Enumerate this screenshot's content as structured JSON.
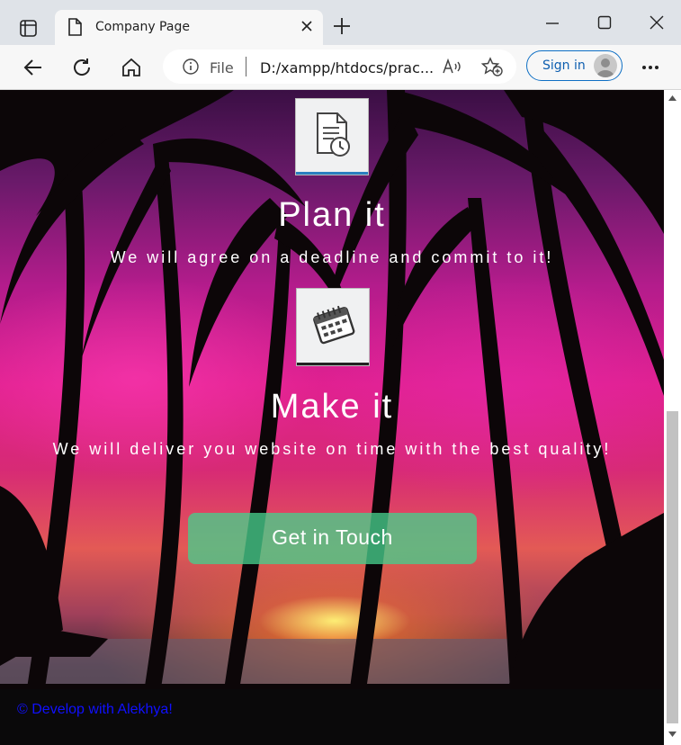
{
  "browser": {
    "tab_title": "Company Page",
    "address_scheme": "File",
    "address_url": "D:/xampp/htdocs/prac...",
    "signin_label": "Sign in",
    "icons": [
      "tab-actions-icon",
      "page-icon",
      "close-icon",
      "plus-icon",
      "minimize-icon",
      "maximize-icon",
      "window-close-icon",
      "back-icon",
      "refresh-icon",
      "home-icon",
      "info-icon",
      "read-aloud-icon",
      "favorite-add-icon",
      "profile-icon",
      "more-icon"
    ]
  },
  "page": {
    "steps": [
      {
        "title": "Plan it",
        "text": "We will agree on a deadline and commit to it!",
        "icon": "document-clock-icon"
      },
      {
        "title": "Make it",
        "text": "We will deliver you website on time with the best quality!",
        "icon": "calendar-icon"
      }
    ],
    "cta_label": "Get in Touch",
    "footer_text": "© Develop with Alekhya!",
    "colors": {
      "cta": "#46cd8c",
      "footer_text": "#1010ff",
      "accent": "#0e6fc4"
    }
  }
}
